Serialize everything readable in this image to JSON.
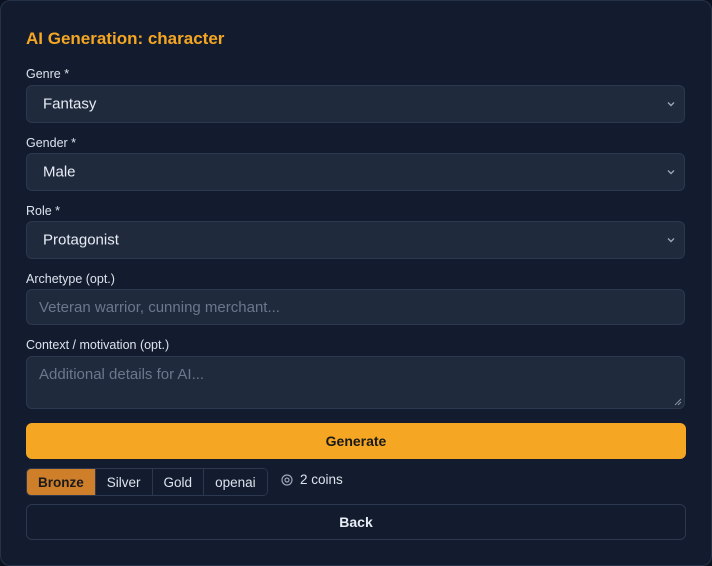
{
  "title": "AI Generation: character",
  "genre": {
    "label": "Genre *",
    "value": "Fantasy"
  },
  "gender": {
    "label": "Gender *",
    "value": "Male"
  },
  "role": {
    "label": "Role *",
    "value": "Protagonist"
  },
  "archetype": {
    "label": "Archetype (opt.)",
    "placeholder": "Veteran warrior, cunning merchant..."
  },
  "context": {
    "label": "Context / motivation (opt.)",
    "placeholder": "Additional details for AI..."
  },
  "generate_label": "Generate",
  "tiers": {
    "selected": "Bronze",
    "items": [
      "Bronze",
      "Silver",
      "Gold",
      "openai"
    ]
  },
  "cost_text": "2 coins",
  "back_label": "Back",
  "colors": {
    "accent": "#f5a623",
    "active_tier": "#cf7f2a",
    "panel": "#131c2e",
    "field": "#1f2a3d"
  }
}
